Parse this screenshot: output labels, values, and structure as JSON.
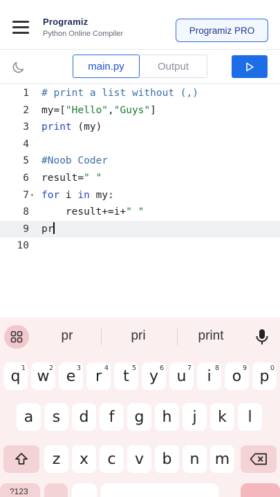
{
  "header": {
    "brand_name": "Programiz",
    "brand_subtitle": "Python Online Compiler",
    "pro_button": "Programiz PRO"
  },
  "tabs": {
    "main": "main.py",
    "output": "Output"
  },
  "editor": {
    "lines": [
      {
        "n": "1",
        "tokens": [
          {
            "t": "# print a list without (,)",
            "c": "comment"
          }
        ]
      },
      {
        "n": "2",
        "tokens": [
          {
            "t": "my=[",
            "c": "plain"
          },
          {
            "t": "\"Hello\"",
            "c": "string"
          },
          {
            "t": ",",
            "c": "plain"
          },
          {
            "t": "\"Guys\"",
            "c": "string"
          },
          {
            "t": "]",
            "c": "plain"
          }
        ]
      },
      {
        "n": "3",
        "tokens": [
          {
            "t": "print",
            "c": "keyword"
          },
          {
            "t": " (my)",
            "c": "plain"
          }
        ]
      },
      {
        "n": "4",
        "tokens": []
      },
      {
        "n": "5",
        "tokens": [
          {
            "t": "#Noob Coder",
            "c": "comment"
          }
        ]
      },
      {
        "n": "6",
        "tokens": [
          {
            "t": "result=",
            "c": "plain"
          },
          {
            "t": "\" \"",
            "c": "string"
          }
        ]
      },
      {
        "n": "7",
        "fold": true,
        "tokens": [
          {
            "t": "for",
            "c": "keyword"
          },
          {
            "t": " i ",
            "c": "plain"
          },
          {
            "t": "in",
            "c": "keyword"
          },
          {
            "t": " my:",
            "c": "plain"
          }
        ]
      },
      {
        "n": "8",
        "tokens": [
          {
            "t": "    result+=i+",
            "c": "plain"
          },
          {
            "t": "\" \"",
            "c": "string"
          }
        ]
      },
      {
        "n": "9",
        "active": true,
        "cursor": true,
        "tokens": [
          {
            "t": "pr",
            "c": "plain"
          }
        ]
      },
      {
        "n": "10",
        "tokens": []
      }
    ]
  },
  "keyboard": {
    "suggestions": [
      "pr",
      "pri",
      "print"
    ],
    "row1": [
      {
        "k": "q",
        "s": "1"
      },
      {
        "k": "w",
        "s": "2"
      },
      {
        "k": "e",
        "s": "3"
      },
      {
        "k": "r",
        "s": "4"
      },
      {
        "k": "t",
        "s": "5"
      },
      {
        "k": "y",
        "s": "6"
      },
      {
        "k": "u",
        "s": "7"
      },
      {
        "k": "i",
        "s": "8"
      },
      {
        "k": "o",
        "s": "9"
      },
      {
        "k": "p",
        "s": "0"
      }
    ],
    "row2": [
      "a",
      "s",
      "d",
      "f",
      "g",
      "h",
      "j",
      "k",
      "l"
    ],
    "row3": [
      "z",
      "x",
      "c",
      "v",
      "b",
      "n",
      "m"
    ],
    "partial_key_label": "?123"
  },
  "colors": {
    "accent": "#1d6ee6",
    "keyword": "#2746c7",
    "string": "#1a7a2f",
    "comment": "#3b6ea5",
    "keyboard_bg": "#fbeff0"
  }
}
